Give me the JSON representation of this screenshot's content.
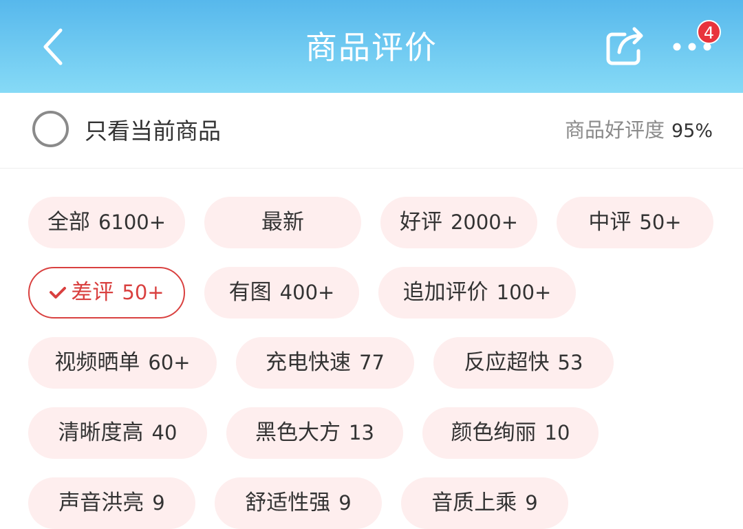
{
  "header": {
    "title": "商品评价",
    "badge_count": "4",
    "gradient": [
      "#57b8ec",
      "#86daf6"
    ]
  },
  "filter": {
    "only_current_label": "只看当前商品",
    "rating_label": "商品好评度",
    "rating_value": "95%"
  },
  "tags": [
    {
      "label": "全部",
      "count": "6100+",
      "selected": false
    },
    {
      "label": "最新",
      "count": "",
      "selected": false
    },
    {
      "label": "好评",
      "count": "2000+",
      "selected": false
    },
    {
      "label": "中评",
      "count": "50+",
      "selected": false
    },
    {
      "label": "差评",
      "count": "50+",
      "selected": true
    },
    {
      "label": "有图",
      "count": "400+",
      "selected": false
    },
    {
      "label": "追加评价",
      "count": "100+",
      "selected": false
    },
    {
      "label": "视频晒单",
      "count": "60+",
      "selected": false
    },
    {
      "label": "充电快速",
      "count": "77",
      "selected": false
    },
    {
      "label": "反应超快",
      "count": "53",
      "selected": false
    },
    {
      "label": "清晰度高",
      "count": "40",
      "selected": false
    },
    {
      "label": "黑色大方",
      "count": "13",
      "selected": false
    },
    {
      "label": "颜色绚丽",
      "count": "10",
      "selected": false
    },
    {
      "label": "声音洪亮",
      "count": "9",
      "selected": false
    },
    {
      "label": "舒适性强",
      "count": "9",
      "selected": false
    },
    {
      "label": "音质上乘",
      "count": "9",
      "selected": false
    }
  ],
  "colors": {
    "tag_bg": "#feeeee",
    "selected_accent": "#d9403f",
    "badge": "#e8333c"
  }
}
